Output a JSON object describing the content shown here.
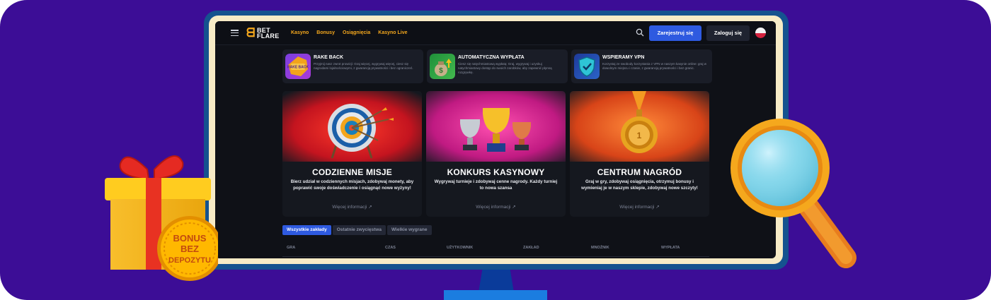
{
  "header": {
    "logo_top": "BET",
    "logo_bottom": "FLARE",
    "nav": [
      "Kasyno",
      "Bonusy",
      "Osiągnięcia",
      "Kasyno Live"
    ],
    "register_label": "Zarejestruj się",
    "login_label": "Zaloguj się"
  },
  "promos": [
    {
      "title": "RAKE BACK",
      "badge": "RAKE BACK",
      "text": "Przyjmij nasz zwrot prowizji: Graj więcej, wygrywaj więcej, ciesz się nagrodami lojalnościowymi, z gwarancją prywatności i bez ograniczeń."
    },
    {
      "title": "AUTOMATYCZNA WYPŁATA",
      "text": "Ciesz się natychmiastową wypłatą: Graj, wygrywaj i uzyskuj natychmiastowy dostęp do swoich zarobków, aby zapewnić płynną rozgrywkę."
    },
    {
      "title": "WSPIERAMY VPN",
      "text": "Korzystaj ze swobody korzystania z VPN w naszym kasynie online: graj w dowolnym miejscu i czasie, z gwarancją prywatności i bez granic."
    }
  ],
  "cards": [
    {
      "title": "CODZIENNE MISJE",
      "text": "Bierz udział w codziennych misjach, zdobywaj monety, aby poprawić swoje doświadczenie i osiągnąć nowe wyżyny!",
      "more": "Więcej informacji"
    },
    {
      "title": "KONKURS KASYNOWY",
      "text": "Wygrywaj turnieje i zdobywaj cenne nagrody. Każdy turniej to nowa szansa",
      "more": "Więcej informacji"
    },
    {
      "title": "CENTRUM NAGRÓD",
      "text": "Graj w gry, zdobywaj osiągnięcia, otrzymuj bonusy i wymieniaj je w naszym sklepie, zdobywaj nowe szczyty!",
      "more": "Więcej informacji"
    }
  ],
  "tabs": [
    "Wszystkie zakłady",
    "Ostatnie zwycięstwa",
    "Wielkie wygrane"
  ],
  "table_headers": [
    "GRA",
    "CZAS",
    "UŻYTKOWNIK",
    "ZAKŁAD",
    "MNOŻNIK",
    "WYPŁATA"
  ],
  "decor": {
    "coin_line1": "BONUS",
    "coin_line2": "BEZ",
    "coin_line3": "DEPOZYTU"
  },
  "colors": {
    "background": "#3c0d96",
    "accent": "#f5a81d",
    "primary_button": "#2e5ae0"
  }
}
